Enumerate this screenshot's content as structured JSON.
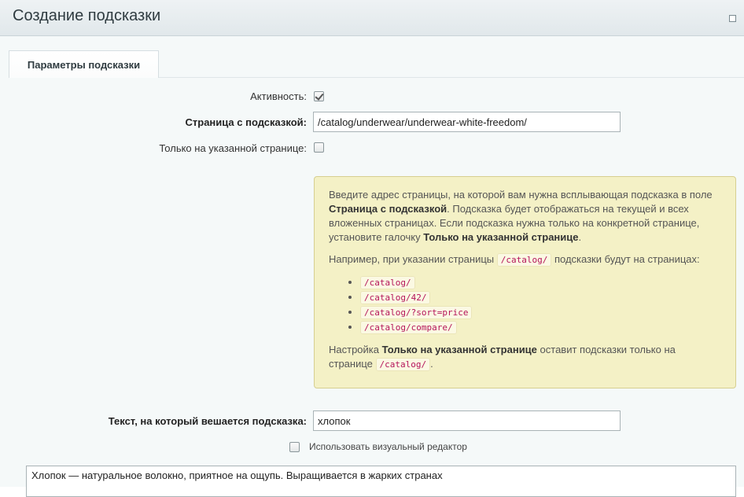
{
  "header": {
    "title": "Создание подсказки"
  },
  "tabs": [
    {
      "label": "Параметры подсказки"
    }
  ],
  "form": {
    "active_label": "Активность:",
    "active_checked": true,
    "page_label": "Страница с подсказкой:",
    "page_value": "/catalog/underwear/underwear-white-freedom/",
    "only_page_label": "Только на указанной странице:",
    "only_page_checked": false,
    "text_label": "Текст, на который вешается подсказка:",
    "text_value": "хлопок",
    "visual_editor_label": "Использовать визуальный редактор",
    "visual_editor_checked": false,
    "hint_text_value": "Хлопок — натуральное волокно, приятное на ощупь. Выращивается в жарких странах"
  },
  "hint": {
    "p1_a": "Введите адрес страницы, на которой вам нужна всплывающая подсказка в поле ",
    "p1_b": "Страница с подсказкой",
    "p1_c": ". Подсказка будет отображаться на текущей и всех вложенных страницах. Если подсказка нужна только на конкретной странице, установите галочку ",
    "p1_d": "Только на указанной странице",
    "p1_e": ".",
    "p2_a": "Например, при указании страницы ",
    "p2_code": "/catalog/",
    "p2_b": " подсказки будут на страницах:",
    "examples": [
      "/catalog/",
      "/catalog/42/",
      "/catalog/?sort=price",
      "/catalog/compare/"
    ],
    "p3_a": "Настройка ",
    "p3_b": "Только на указанной странице",
    "p3_c": " оставит подсказки только на странице ",
    "p3_code": "/catalog/",
    "p3_d": "."
  }
}
